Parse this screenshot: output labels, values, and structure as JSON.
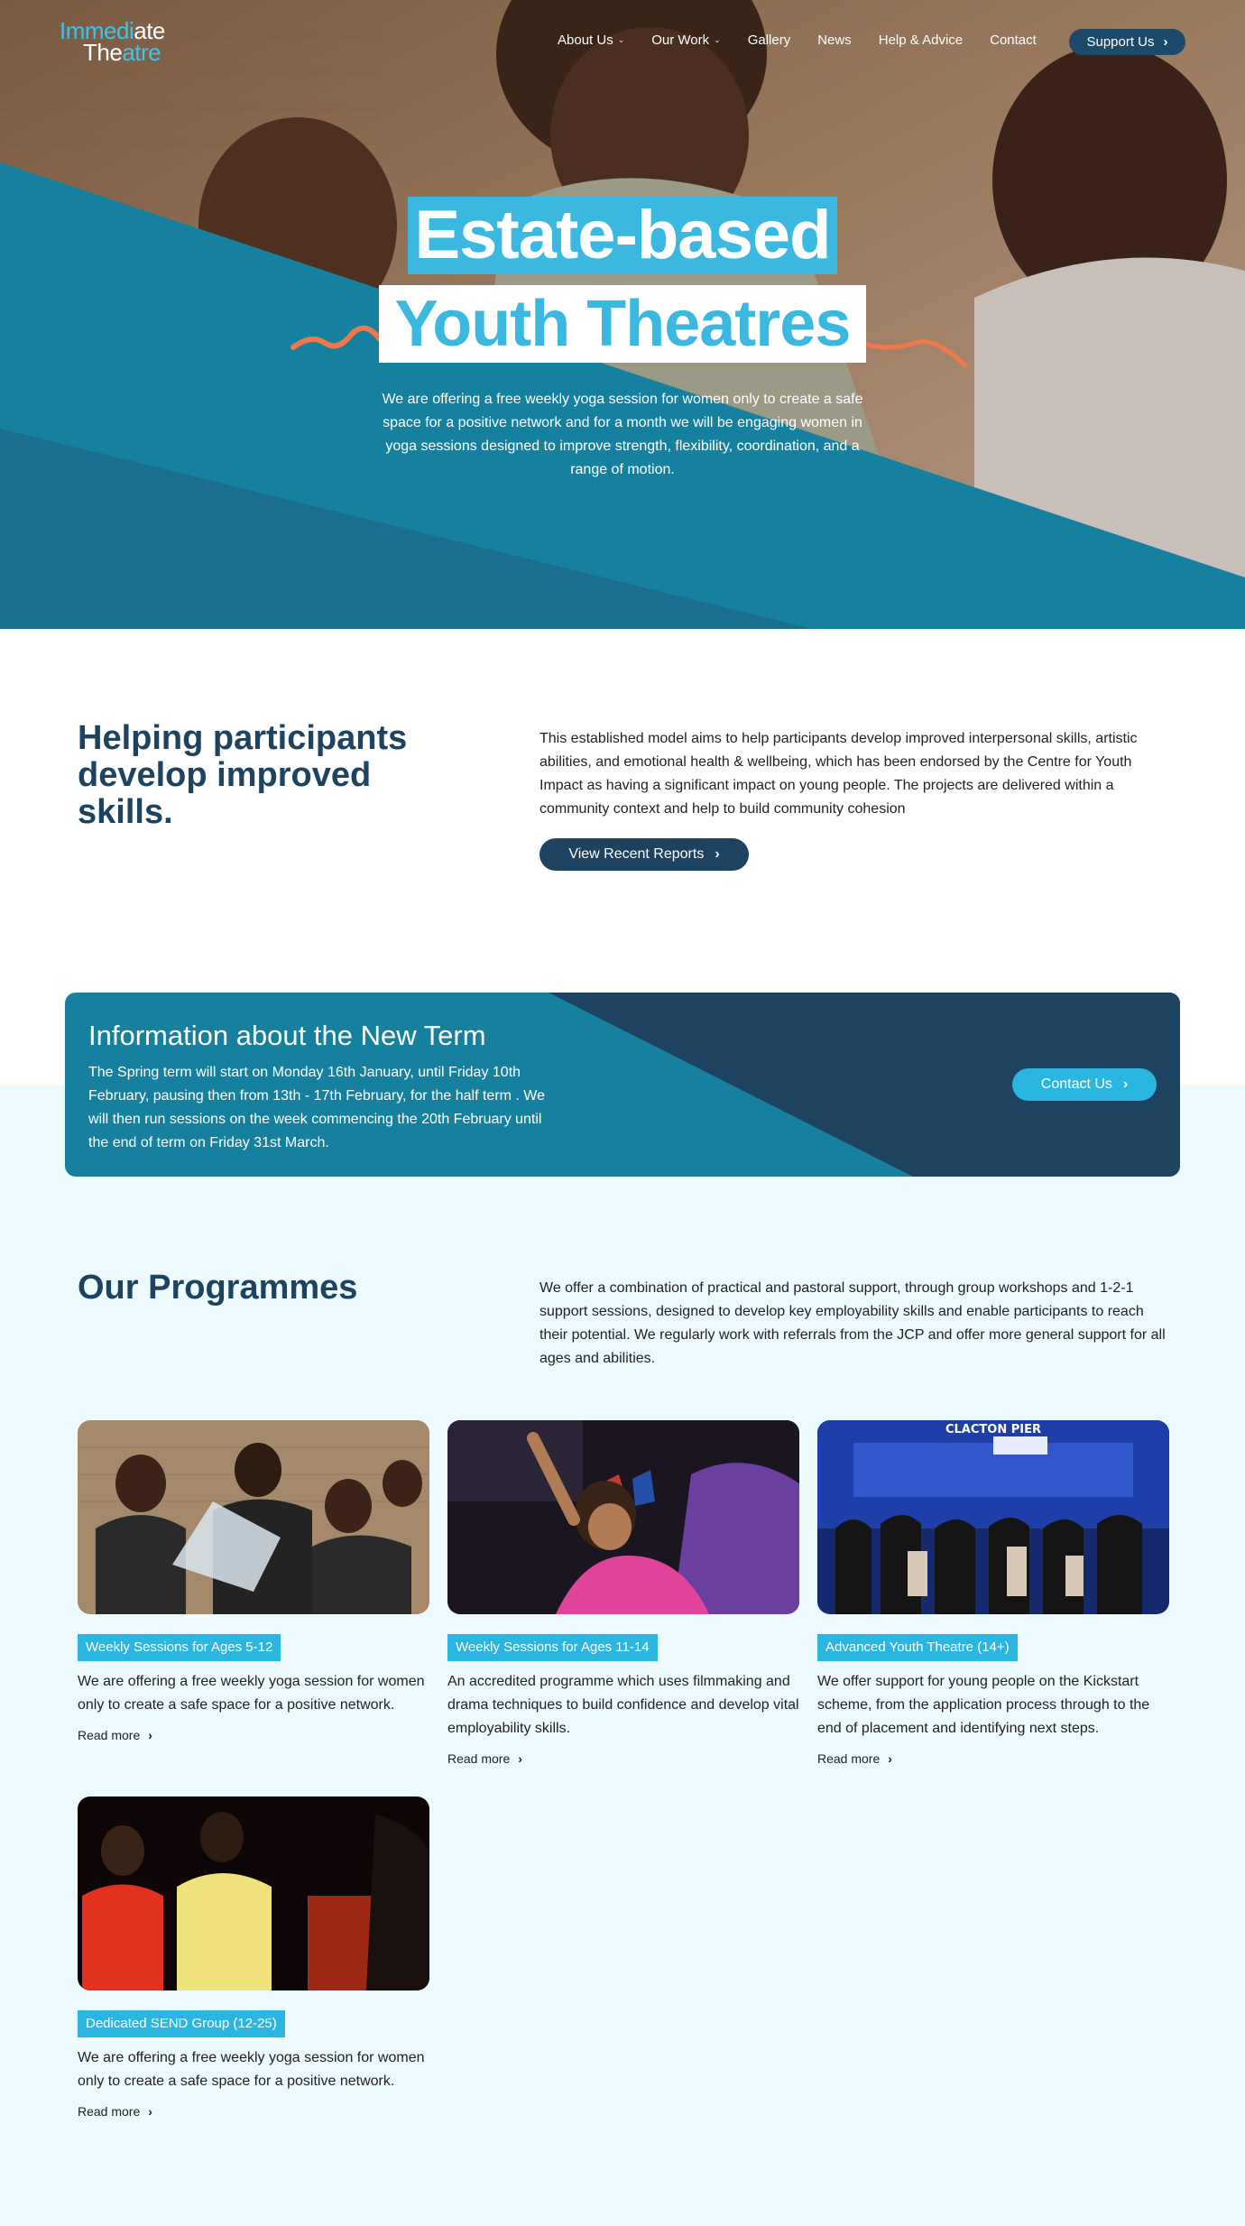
{
  "brand": {
    "logo_line1_a": "Immedi",
    "logo_line1_b": "ate",
    "logo_line2_a": "The",
    "logo_line2_b": "atre",
    "accent": "#2ab6e0",
    "navy": "#1d4360",
    "teal": "#16809f"
  },
  "nav": {
    "items": [
      {
        "label": "About Us",
        "has_dropdown": true
      },
      {
        "label": "Our Work",
        "has_dropdown": true
      },
      {
        "label": "Gallery",
        "has_dropdown": false
      },
      {
        "label": "News",
        "has_dropdown": false
      },
      {
        "label": "Help & Advice",
        "has_dropdown": false
      },
      {
        "label": "Contact",
        "has_dropdown": false
      }
    ],
    "support_label": "Support Us",
    "dropdown_icon": "chevron-down-icon",
    "support_icon": "chevron-right-icon"
  },
  "hero": {
    "title_line1": "Estate-based",
    "title_line2": "Youth Theatres",
    "description": "We are offering a free weekly yoga session for women only to create a safe space for a positive network and for a month we will be engaging women in yoga sessions designed to improve strength, flexibility, coordination, and a range of motion."
  },
  "helping": {
    "title": "Helping participants develop improved skills.",
    "text": "This established model aims to help participants develop improved interpersonal skills, artistic abilities, and emotional health & wellbeing, which has been endorsed by the Centre for Youth Impact as having a significant impact on young people. The projects are delivered within a community context and help to build community cohesion",
    "button_label": "View Recent Reports"
  },
  "term": {
    "title": "Information about the New Term",
    "text": "The Spring term will start on Monday 16th January, until Friday 10th February, pausing then from 13th - 17th February, for the half term . We will then run sessions on the week commencing the 20th February until the end of term on Friday 31st March.",
    "button_label": "Contact Us"
  },
  "programmes": {
    "title": "Our Programmes",
    "text": "We offer a combination of practical and pastoral support, through group workshops and 1-2-1 support sessions, designed to develop key employability skills and enable participants to reach their potential. We regularly work with referrals from the JCP and offer more general support for all ages and abilities.",
    "read_more": "Read more",
    "cards": [
      {
        "tag": "Weekly Sessions for Ages 5-12",
        "text": "We are offering a free weekly yoga session for women only to create a safe space for a positive network.",
        "more": "Read more"
      },
      {
        "tag": "Weekly Sessions for Ages 11-14",
        "text": "An accredited programme which uses filmmaking and drama techniques to build confidence and develop vital employability skills.",
        "more": "Read more"
      },
      {
        "tag": "Advanced Youth Theatre (14+)",
        "text": "We offer support for young people on the Kickstart scheme, from the application process through to the end of placement and identifying next steps.",
        "more": "Read more"
      },
      {
        "tag": "Dedicated SEND Group (12-25)",
        "text": "We are offering a free weekly yoga session for women only to create a safe space for a positive network.",
        "more": "Read more"
      }
    ],
    "card3_sign": "CLACTON PIER"
  }
}
